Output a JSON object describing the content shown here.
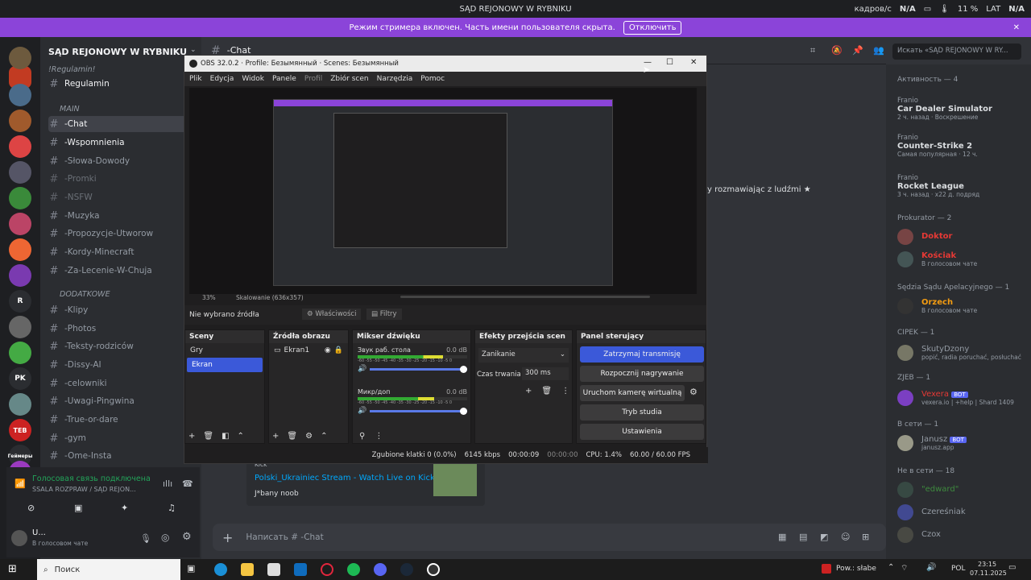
{
  "topbar": {
    "title": "SĄD REJONOWY W RYBNIKU",
    "ping_label": "кадров/с",
    "ping_value": "N/A",
    "battery": "11 %",
    "lat_label": "LAT",
    "lat_value": "N/A"
  },
  "notice": {
    "text": "Режим стримера включен. Часть имени пользователя скрыта.",
    "button": "Отключить"
  },
  "guild": {
    "name": "SĄD REJONOWY W RYBNIKU",
    "channels": [
      {
        "name": "!Regulamin!",
        "type": "cat"
      },
      {
        "name": "Regulamin",
        "type": "ch"
      },
      {
        "name": "MAIN",
        "type": "cat"
      },
      {
        "name": "-Chat",
        "type": "ch",
        "active": true
      },
      {
        "name": "-Wspomnienia",
        "type": "ch",
        "bright": true
      },
      {
        "name": "-Słowa-Dowody",
        "type": "ch"
      },
      {
        "name": "-Promki",
        "type": "ch"
      },
      {
        "name": "-NSFW",
        "type": "ch"
      },
      {
        "name": "-Muzyka",
        "type": "ch"
      },
      {
        "name": "-Propozycje-Utworow",
        "type": "ch"
      },
      {
        "name": "-Kordy-Minecraft",
        "type": "ch"
      },
      {
        "name": "-Za-Lecenie-W-Chuja",
        "type": "ch"
      },
      {
        "name": "DODATKOWE",
        "type": "cat"
      },
      {
        "name": "-Klipy",
        "type": "ch"
      },
      {
        "name": "-Photos",
        "type": "ch"
      },
      {
        "name": "-Teksty-rodziców",
        "type": "ch"
      },
      {
        "name": "-Dissy-AI",
        "type": "ch"
      },
      {
        "name": "-celowniki",
        "type": "ch"
      },
      {
        "name": "-Uwagi-Pingwina",
        "type": "ch"
      },
      {
        "name": "-True-or-dare",
        "type": "ch"
      },
      {
        "name": "-gym",
        "type": "ch"
      },
      {
        "name": "-Ome-Insta",
        "type": "ch"
      }
    ]
  },
  "voice": {
    "status": "Голосовая связь подключена",
    "channel": "ŚSALA ROZPRAW / SĄD REJON..."
  },
  "user": {
    "name": "U...",
    "status": "В голосовом чате"
  },
  "chat": {
    "channel": "-Chat",
    "search_placeholder": "Искать «SĄD REJONOWY W RY...",
    "message_fragment": "y rozmawiając z ludźmi ★",
    "embed_provider": "Kick",
    "embed_title": "Polski_Ukrainiec Stream - Watch Live on Kick",
    "embed_msg": "J*bany noob",
    "input_placeholder": "Написать # -Chat"
  },
  "members": {
    "activity_title": "Активность — 4",
    "activities": [
      {
        "user": "Franio",
        "game": "Car Dealer Simulator",
        "sub": "2 ч. назад · Воскрешение"
      },
      {
        "user": "Franio",
        "game": "Counter-Strike 2",
        "sub": "Самая популярная · 12 ч."
      },
      {
        "user": "Franio",
        "game": "Rocket League",
        "sub": "3 ч. назад · x22 д. подряд"
      }
    ],
    "groups": [
      {
        "title": "Prokurator — 2",
        "items": [
          {
            "name": "Doktor",
            "sub": ""
          },
          {
            "name": "Kościak",
            "sub": "В голосовом чате"
          }
        ]
      },
      {
        "title": "Sędzia Sądu Apelacyjnego — 1",
        "items": [
          {
            "name": "Orzech",
            "sub": "В голосовом чате"
          }
        ]
      },
      {
        "title": "CIPEK — 1",
        "items": [
          {
            "name": "SkutyDzony",
            "sub": "popić, radia poruchać, posłuchać"
          }
        ]
      },
      {
        "title": "ZJEB — 1",
        "items": [
          {
            "name": "Vexera",
            "sub": "vexera.io | +help | Shard 1409",
            "bot": "BOT"
          }
        ]
      },
      {
        "title": "В сети — 1",
        "items": [
          {
            "name": "Janusz",
            "sub": "janusz.app",
            "bot": "BOT"
          }
        ]
      },
      {
        "title": "Не в сети — 18",
        "items": [
          {
            "name": "\"edward\"",
            "sub": ""
          },
          {
            "name": "Czereśniak",
            "sub": ""
          },
          {
            "name": "Czox",
            "sub": ""
          }
        ]
      }
    ]
  },
  "obs": {
    "title": "OBS 32.0.2 · Profile: Безымянный · Scenes: Безымянный",
    "menu": [
      "Plik",
      "Edycja",
      "Widok",
      "Panele",
      "Profil",
      "Zbiór scen",
      "Narzędzia",
      "Pomoc"
    ],
    "zoom": "33%",
    "scaling": "Skalowanie (636x357)",
    "no_source": "Nie wybrano źródła",
    "properties": "Właściwości",
    "filters": "Filtry",
    "scenes_title": "Sceny",
    "scenes": [
      "Gry",
      "Ekran"
    ],
    "sources_title": "Źródła obrazu",
    "source": "Ekran1",
    "mixer_title": "Mikser dźwięku",
    "mixer": [
      {
        "name": "Звук раб. стола",
        "db": "0.0 dB",
        "level": 0.78
      },
      {
        "name": "Микр/доп",
        "db": "0.0 dB",
        "level": 0.7
      }
    ],
    "mixer_scale": "-60 -55 -50 -45 -40 -35 -30 -25 -20 -15 -10 -5 0",
    "transitions_title": "Efekty przejścia scen",
    "transition": "Zanikanie",
    "duration_label": "Czas trwania",
    "duration": "300 ms",
    "controls_title": "Panel sterujący",
    "controls": [
      "Zatrzymaj transmisję",
      "Rozpocznij nagrywanie",
      "Uruchom kamerę wirtualną",
      "Tryb studia",
      "Ustawienia"
    ],
    "status": {
      "dropped": "Zgubione klatki 0 (0.0%)",
      "kbps": "6145 kbps",
      "stream_time": "00:00:09",
      "rec_time": "00:00:00",
      "cpu": "CPU: 1.4%",
      "fps": "60.00 / 60.00 FPS"
    }
  },
  "taskbar": {
    "search": "Поиск",
    "weather": "Pow.: słabe",
    "lang": "POL",
    "time": "23:15",
    "date": "07.11.2025"
  },
  "colors": {
    "accent": "#8b44d9",
    "obs_active": "#3b59d9",
    "discord_bg": "#313338"
  }
}
